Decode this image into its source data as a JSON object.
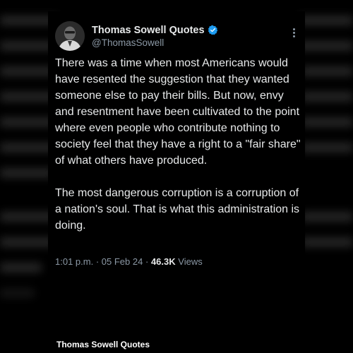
{
  "tweet": {
    "display_name": "Thomas Sowell Quotes",
    "handle": "@ThomasSowell",
    "paragraphs": [
      "There was a time when most Americans would have resented the suggestion that they wanted someone else to pay their bills. But now, envy and resentment have been cultivated to the point where even people who contribute nothing to society feel that they have a right to a \"fair share\" of what others have produced.",
      "The most dangerous corruption is a corruption of a nation's soul. That is what this administration is doing."
    ],
    "time": "1:01 p.m.",
    "separator": "·",
    "date": "05 Feb 24",
    "views_count": "46.3K",
    "views_label": "Views"
  },
  "icons": {
    "verified": "verified-badge-icon",
    "more": "more-options-icon"
  },
  "colors": {
    "background": "#000000",
    "text": "#e7e9ea",
    "secondary": "#8b98a5",
    "verified": "#1d9bf0"
  },
  "footer": {
    "caption": "Thomas Sowell Quotes"
  }
}
